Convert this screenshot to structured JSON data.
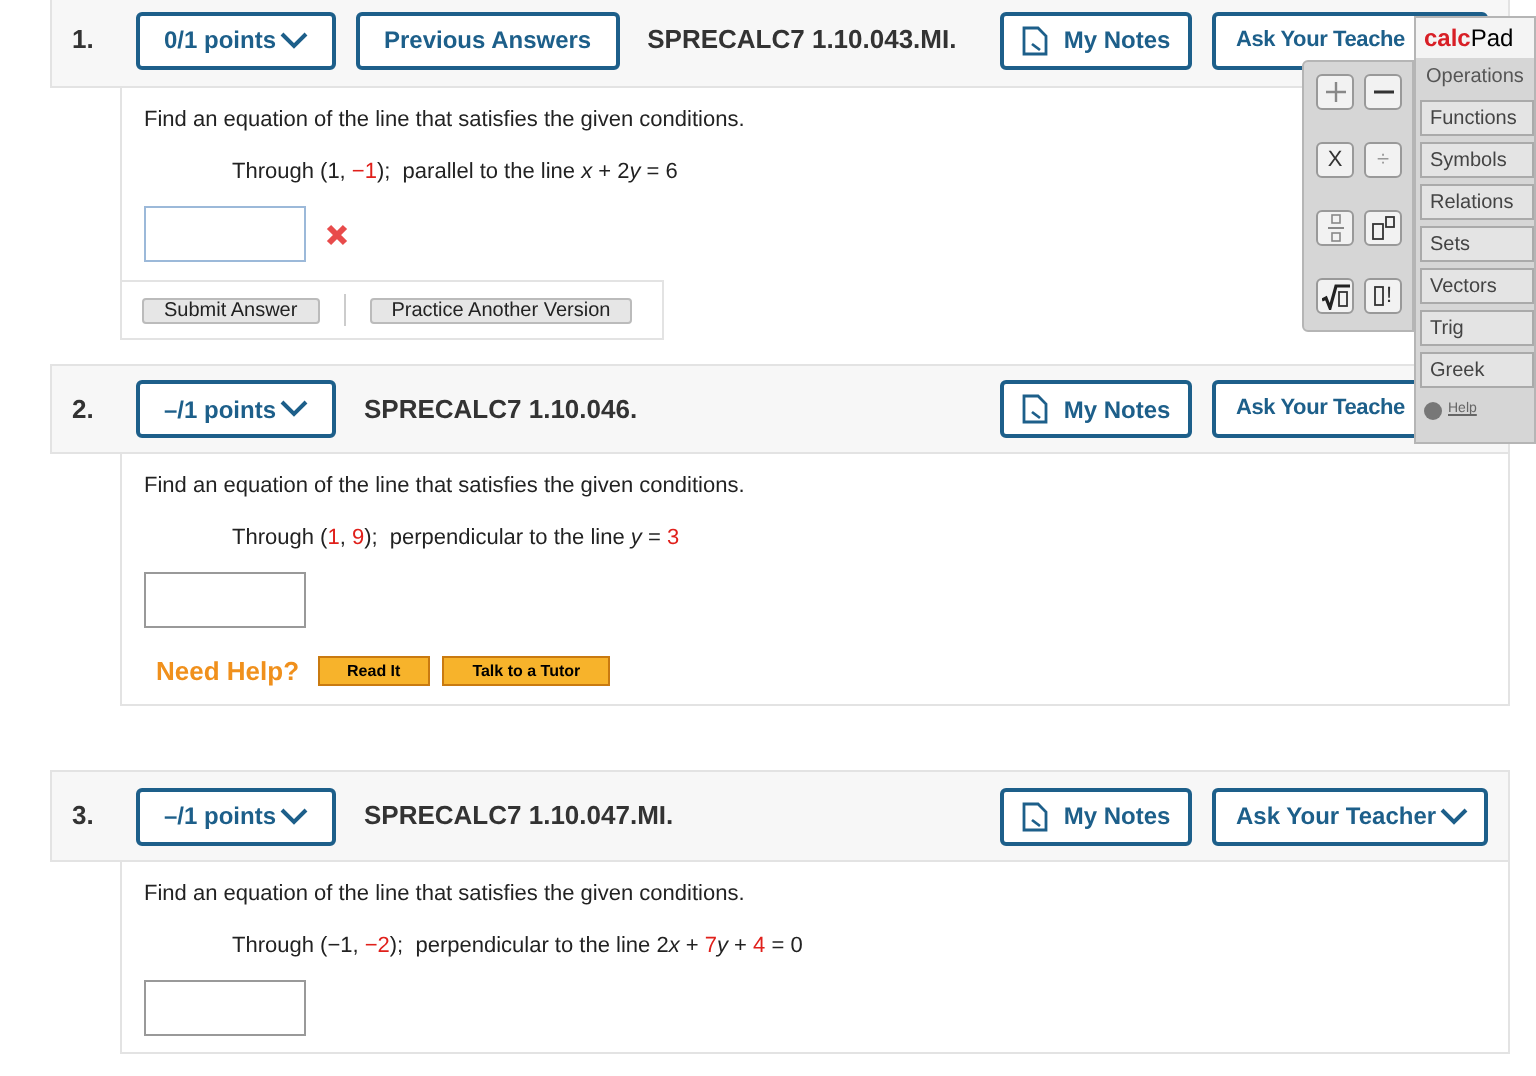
{
  "questions": [
    {
      "number": "1.",
      "points": "0/1 points",
      "previous_answers": "Previous Answers",
      "code": "SPRECALC7 1.10.043.MI.",
      "my_notes": "My Notes",
      "ask_teacher": "Ask Your Teache",
      "prompt": "Find an equation of the line that satisfies the given conditions.",
      "condition": [
        {
          "kind": "plain",
          "text": "Through (1, "
        },
        {
          "kind": "highlight",
          "text": "−1"
        },
        {
          "kind": "plain",
          "text": ");  parallel to the line "
        },
        {
          "kind": "variable",
          "text": "x"
        },
        {
          "kind": "plain",
          "text": " + 2"
        },
        {
          "kind": "variable",
          "text": "y"
        },
        {
          "kind": "plain",
          "text": " = 6"
        }
      ],
      "answer_incorrect": true,
      "actions": [
        "Submit Answer",
        "Practice Another Version"
      ]
    },
    {
      "number": "2.",
      "points": "–/1 points",
      "code": "SPRECALC7 1.10.046.",
      "my_notes": "My Notes",
      "ask_teacher": "Ask Your Teache",
      "prompt": "Find an equation of the line that satisfies the given conditions.",
      "condition": [
        {
          "kind": "plain",
          "text": "Through ("
        },
        {
          "kind": "highlight",
          "text": "1"
        },
        {
          "kind": "plain",
          "text": ", "
        },
        {
          "kind": "highlight",
          "text": "9"
        },
        {
          "kind": "plain",
          "text": ");  perpendicular to the line "
        },
        {
          "kind": "variable",
          "text": "y"
        },
        {
          "kind": "plain",
          "text": " = "
        },
        {
          "kind": "highlight",
          "text": "3"
        }
      ],
      "answer_incorrect": false,
      "need_help": {
        "label": "Need Help?",
        "buttons": [
          "Read It",
          "Talk to a Tutor"
        ]
      }
    },
    {
      "number": "3.",
      "points": "–/1 points",
      "code": "SPRECALC7 1.10.047.MI.",
      "my_notes": "My Notes",
      "ask_teacher": "Ask Your Teacher",
      "ask_dropdown": true,
      "prompt": "Find an equation of the line that satisfies the given conditions.",
      "condition": [
        {
          "kind": "plain",
          "text": "Through (−1, "
        },
        {
          "kind": "highlight",
          "text": "−2"
        },
        {
          "kind": "plain",
          "text": ");  perpendicular to the line 2"
        },
        {
          "kind": "variable",
          "text": "x"
        },
        {
          "kind": "plain",
          "text": " + "
        },
        {
          "kind": "highlight",
          "text": "7"
        },
        {
          "kind": "variable",
          "text": "y"
        },
        {
          "kind": "plain",
          "text": " + "
        },
        {
          "kind": "highlight",
          "text": "4"
        },
        {
          "kind": "plain",
          "text": " = 0"
        }
      ],
      "answer_incorrect": false
    }
  ],
  "calcpad": {
    "title_bold": "calc",
    "title_rest": "Pad",
    "keys": [
      {
        "kind": "plus"
      },
      {
        "kind": "minus"
      },
      {
        "kind": "times",
        "text": "X"
      },
      {
        "kind": "divide",
        "text": "÷"
      },
      {
        "kind": "fraction"
      },
      {
        "kind": "power"
      },
      {
        "kind": "sqrt"
      },
      {
        "kind": "factorial",
        "text": "!"
      }
    ],
    "tabs": [
      {
        "label": "Operations",
        "selected": true
      },
      {
        "label": "Functions",
        "selected": false
      },
      {
        "label": "Symbols",
        "selected": false
      },
      {
        "label": "Relations",
        "selected": false
      },
      {
        "label": "Sets",
        "selected": false
      },
      {
        "label": "Vectors",
        "selected": false
      },
      {
        "label": "Trig",
        "selected": false
      },
      {
        "label": "Greek",
        "selected": false
      }
    ],
    "help": "Help"
  }
}
